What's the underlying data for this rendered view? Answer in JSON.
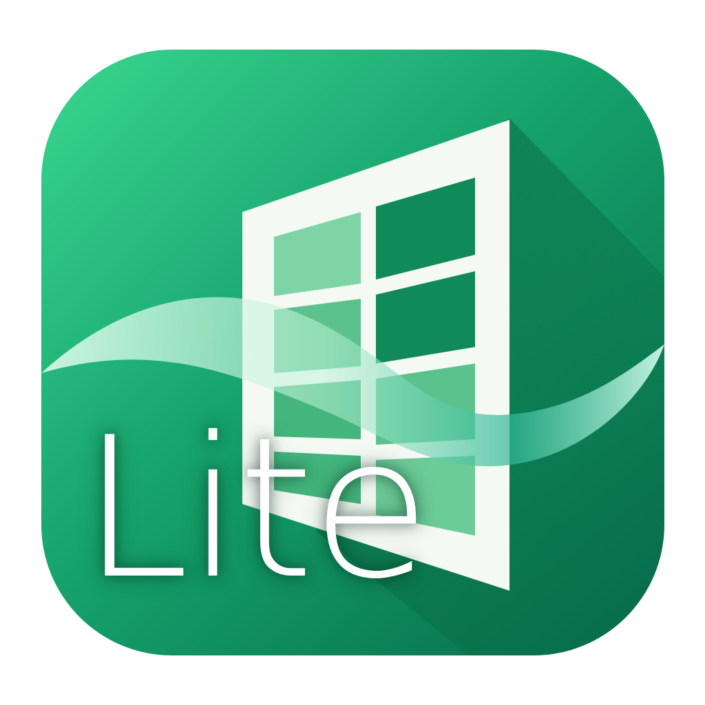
{
  "badge": {
    "text": "Lite"
  },
  "icons": {
    "app": "window-app-icon",
    "window": "window-icon",
    "wave": "wave-icon"
  },
  "colors": {
    "background_light": "#3ad690",
    "background_mid": "#149b66",
    "background_dark": "#07704a",
    "window_frame": "#f4f9f4",
    "pane_light": "#7fd4a6",
    "pane_dark": "#0f8a58",
    "label": "#ffffff"
  }
}
